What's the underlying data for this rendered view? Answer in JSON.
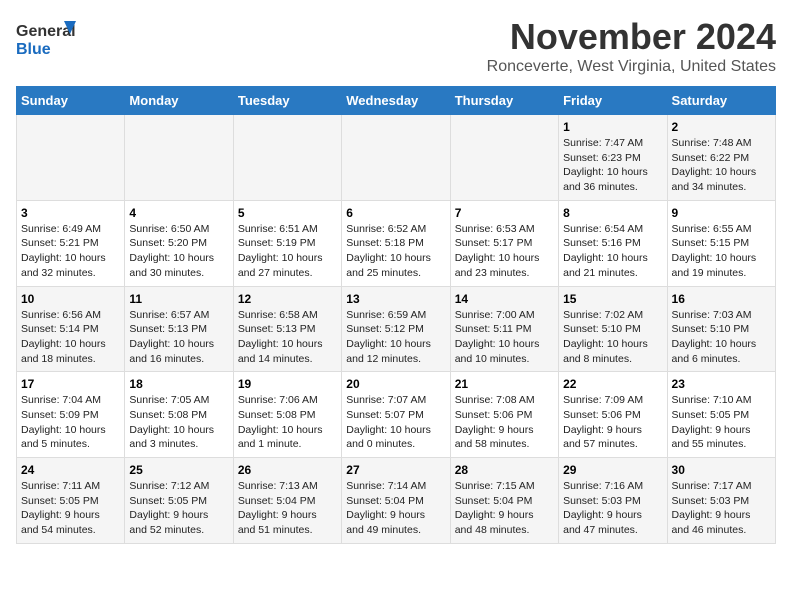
{
  "header": {
    "logo_line1": "General",
    "logo_line2": "Blue",
    "title": "November 2024",
    "subtitle": "Ronceverte, West Virginia, United States"
  },
  "calendar": {
    "days_of_week": [
      "Sunday",
      "Monday",
      "Tuesday",
      "Wednesday",
      "Thursday",
      "Friday",
      "Saturday"
    ],
    "weeks": [
      [
        {
          "day": "",
          "info": ""
        },
        {
          "day": "",
          "info": ""
        },
        {
          "day": "",
          "info": ""
        },
        {
          "day": "",
          "info": ""
        },
        {
          "day": "",
          "info": ""
        },
        {
          "day": "1",
          "info": "Sunrise: 7:47 AM\nSunset: 6:23 PM\nDaylight: 10 hours\nand 36 minutes."
        },
        {
          "day": "2",
          "info": "Sunrise: 7:48 AM\nSunset: 6:22 PM\nDaylight: 10 hours\nand 34 minutes."
        }
      ],
      [
        {
          "day": "3",
          "info": "Sunrise: 6:49 AM\nSunset: 5:21 PM\nDaylight: 10 hours\nand 32 minutes."
        },
        {
          "day": "4",
          "info": "Sunrise: 6:50 AM\nSunset: 5:20 PM\nDaylight: 10 hours\nand 30 minutes."
        },
        {
          "day": "5",
          "info": "Sunrise: 6:51 AM\nSunset: 5:19 PM\nDaylight: 10 hours\nand 27 minutes."
        },
        {
          "day": "6",
          "info": "Sunrise: 6:52 AM\nSunset: 5:18 PM\nDaylight: 10 hours\nand 25 minutes."
        },
        {
          "day": "7",
          "info": "Sunrise: 6:53 AM\nSunset: 5:17 PM\nDaylight: 10 hours\nand 23 minutes."
        },
        {
          "day": "8",
          "info": "Sunrise: 6:54 AM\nSunset: 5:16 PM\nDaylight: 10 hours\nand 21 minutes."
        },
        {
          "day": "9",
          "info": "Sunrise: 6:55 AM\nSunset: 5:15 PM\nDaylight: 10 hours\nand 19 minutes."
        }
      ],
      [
        {
          "day": "10",
          "info": "Sunrise: 6:56 AM\nSunset: 5:14 PM\nDaylight: 10 hours\nand 18 minutes."
        },
        {
          "day": "11",
          "info": "Sunrise: 6:57 AM\nSunset: 5:13 PM\nDaylight: 10 hours\nand 16 minutes."
        },
        {
          "day": "12",
          "info": "Sunrise: 6:58 AM\nSunset: 5:13 PM\nDaylight: 10 hours\nand 14 minutes."
        },
        {
          "day": "13",
          "info": "Sunrise: 6:59 AM\nSunset: 5:12 PM\nDaylight: 10 hours\nand 12 minutes."
        },
        {
          "day": "14",
          "info": "Sunrise: 7:00 AM\nSunset: 5:11 PM\nDaylight: 10 hours\nand 10 minutes."
        },
        {
          "day": "15",
          "info": "Sunrise: 7:02 AM\nSunset: 5:10 PM\nDaylight: 10 hours\nand 8 minutes."
        },
        {
          "day": "16",
          "info": "Sunrise: 7:03 AM\nSunset: 5:10 PM\nDaylight: 10 hours\nand 6 minutes."
        }
      ],
      [
        {
          "day": "17",
          "info": "Sunrise: 7:04 AM\nSunset: 5:09 PM\nDaylight: 10 hours\nand 5 minutes."
        },
        {
          "day": "18",
          "info": "Sunrise: 7:05 AM\nSunset: 5:08 PM\nDaylight: 10 hours\nand 3 minutes."
        },
        {
          "day": "19",
          "info": "Sunrise: 7:06 AM\nSunset: 5:08 PM\nDaylight: 10 hours\nand 1 minute."
        },
        {
          "day": "20",
          "info": "Sunrise: 7:07 AM\nSunset: 5:07 PM\nDaylight: 10 hours\nand 0 minutes."
        },
        {
          "day": "21",
          "info": "Sunrise: 7:08 AM\nSunset: 5:06 PM\nDaylight: 9 hours\nand 58 minutes."
        },
        {
          "day": "22",
          "info": "Sunrise: 7:09 AM\nSunset: 5:06 PM\nDaylight: 9 hours\nand 57 minutes."
        },
        {
          "day": "23",
          "info": "Sunrise: 7:10 AM\nSunset: 5:05 PM\nDaylight: 9 hours\nand 55 minutes."
        }
      ],
      [
        {
          "day": "24",
          "info": "Sunrise: 7:11 AM\nSunset: 5:05 PM\nDaylight: 9 hours\nand 54 minutes."
        },
        {
          "day": "25",
          "info": "Sunrise: 7:12 AM\nSunset: 5:05 PM\nDaylight: 9 hours\nand 52 minutes."
        },
        {
          "day": "26",
          "info": "Sunrise: 7:13 AM\nSunset: 5:04 PM\nDaylight: 9 hours\nand 51 minutes."
        },
        {
          "day": "27",
          "info": "Sunrise: 7:14 AM\nSunset: 5:04 PM\nDaylight: 9 hours\nand 49 minutes."
        },
        {
          "day": "28",
          "info": "Sunrise: 7:15 AM\nSunset: 5:04 PM\nDaylight: 9 hours\nand 48 minutes."
        },
        {
          "day": "29",
          "info": "Sunrise: 7:16 AM\nSunset: 5:03 PM\nDaylight: 9 hours\nand 47 minutes."
        },
        {
          "day": "30",
          "info": "Sunrise: 7:17 AM\nSunset: 5:03 PM\nDaylight: 9 hours\nand 46 minutes."
        }
      ]
    ]
  }
}
